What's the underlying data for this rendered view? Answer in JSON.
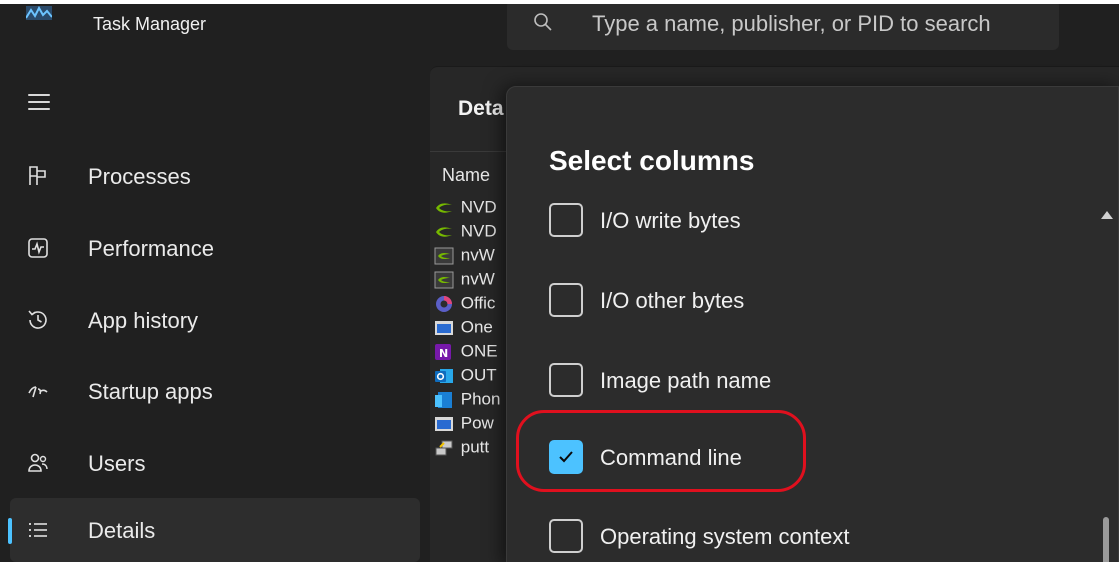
{
  "window": {
    "title": "Task Manager",
    "app_icon": "task-manager-chart-icon"
  },
  "search": {
    "placeholder": "Type a name, publisher, or PID to search",
    "icon": "search-icon"
  },
  "sidebar": {
    "menu_icon": "hamburger-icon",
    "items": [
      {
        "label": "Processes",
        "icon": "processes-grid-icon",
        "active": false
      },
      {
        "label": "Performance",
        "icon": "performance-pulse-icon",
        "active": false
      },
      {
        "label": "App history",
        "icon": "history-icon",
        "active": false
      },
      {
        "label": "Startup apps",
        "icon": "startup-speedometer-icon",
        "active": false
      },
      {
        "label": "Users",
        "icon": "users-icon",
        "active": false
      },
      {
        "label": "Details",
        "icon": "details-list-icon",
        "active": true
      }
    ]
  },
  "details": {
    "title": "Deta",
    "column_name": "Name",
    "rows": [
      {
        "name": "NVD",
        "icon": "nvidia-icon"
      },
      {
        "name": "NVD",
        "icon": "nvidia-icon"
      },
      {
        "name": "nvW",
        "icon": "nvidia-box-icon"
      },
      {
        "name": "nvW",
        "icon": "nvidia-box-icon"
      },
      {
        "name": "Offic",
        "icon": "office-icon"
      },
      {
        "name": "One",
        "icon": "app-window-icon"
      },
      {
        "name": "ONE",
        "icon": "onenote-icon"
      },
      {
        "name": "OUT",
        "icon": "outlook-icon"
      },
      {
        "name": "Phon",
        "icon": "phone-link-icon"
      },
      {
        "name": "Pow",
        "icon": "app-window-icon"
      },
      {
        "name": "putt",
        "icon": "putty-icon"
      }
    ]
  },
  "flyout": {
    "title": "Select columns",
    "options": [
      {
        "label": "I/O write bytes",
        "checked": false
      },
      {
        "label": "I/O other bytes",
        "checked": false
      },
      {
        "label": "Image path name",
        "checked": false
      },
      {
        "label": "Command line",
        "checked": true
      },
      {
        "label": "Operating system context",
        "checked": false
      }
    ]
  },
  "colors": {
    "accent": "#4cc2ff",
    "highlight_ring": "#e0101e",
    "background": "#202020"
  }
}
